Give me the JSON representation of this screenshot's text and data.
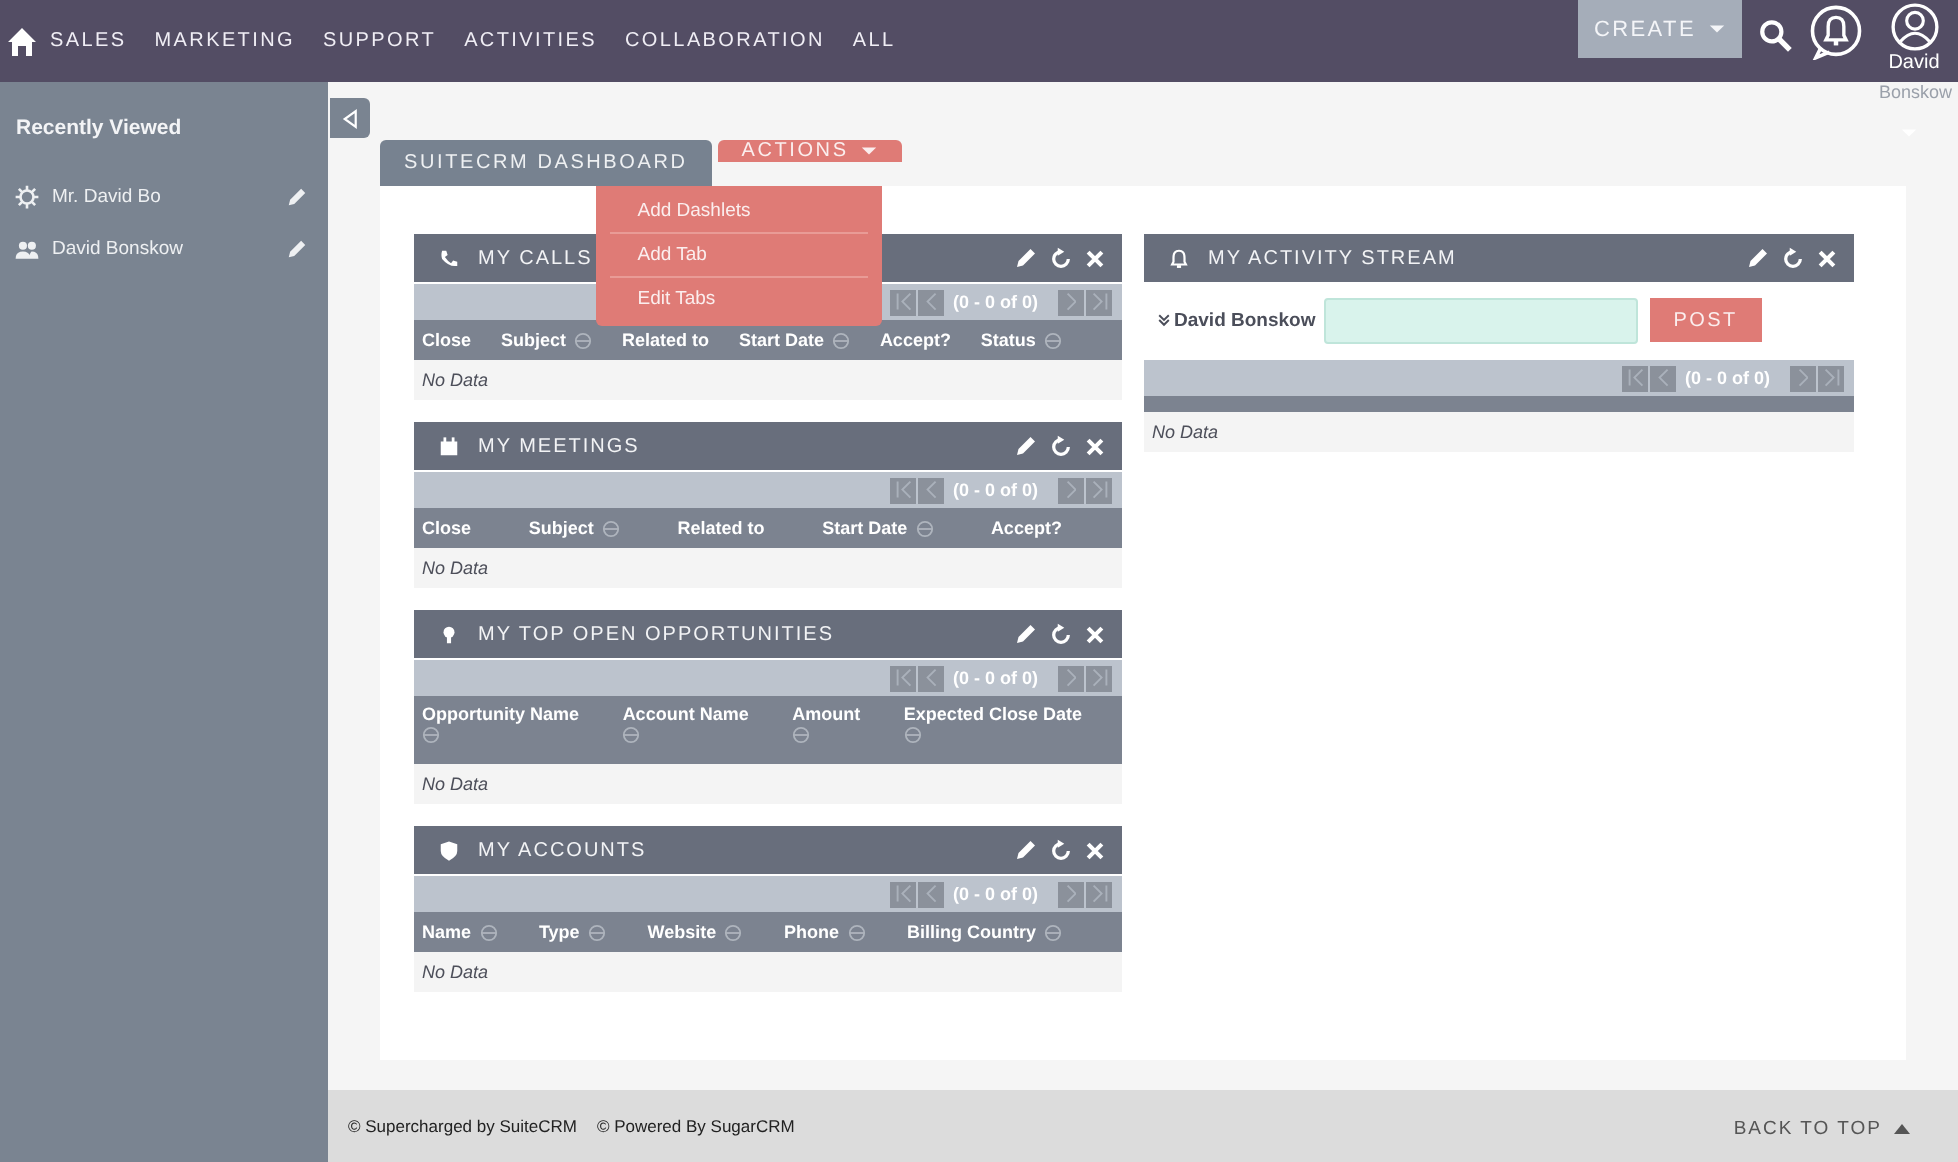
{
  "nav": [
    "SALES",
    "MARKETING",
    "SUPPORT",
    "ACTIVITIES",
    "COLLABORATION",
    "ALL"
  ],
  "top_actions": {
    "create": "CREATE",
    "user_first": "David",
    "user_last": "Bonskow"
  },
  "sidebar": {
    "title": "Recently Viewed",
    "items": [
      {
        "label": "Mr. David Bo",
        "kind": "target"
      },
      {
        "label": "David Bonskow",
        "kind": "contact"
      }
    ]
  },
  "tabs": {
    "dashboard": "SUITECRM DASHBOARD",
    "actions": {
      "label": "ACTIONS",
      "expanded": true,
      "items": [
        "Add Dashlets",
        "Add Tab",
        "Edit Tabs"
      ]
    }
  },
  "dashlets": {
    "left": [
      {
        "kind": "calls",
        "title": "MY CALLS",
        "pagination": "(0 - 0 of 0)",
        "sort_below": false,
        "columns": [
          {
            "label": "Close",
            "sortable": false
          },
          {
            "label": "Subject",
            "sortable": true
          },
          {
            "label": "Related to",
            "sortable": false
          },
          {
            "label": "Start Date",
            "sortable": true
          },
          {
            "label": "Accept?",
            "sortable": false
          },
          {
            "label": "Status",
            "sortable": true
          }
        ],
        "empty": "No Data"
      },
      {
        "kind": "meetings",
        "title": "MY MEETINGS",
        "pagination": "(0 - 0 of 0)",
        "sort_below": false,
        "columns": [
          {
            "label": "Close",
            "sortable": false
          },
          {
            "label": "Subject",
            "sortable": true
          },
          {
            "label": "Related to",
            "sortable": false
          },
          {
            "label": "Start Date",
            "sortable": true
          },
          {
            "label": "Accept?",
            "sortable": false
          }
        ],
        "empty": "No Data"
      },
      {
        "kind": "opportunities",
        "title": "MY TOP OPEN OPPORTUNITIES",
        "pagination": "(0 - 0 of 0)",
        "sort_below": true,
        "columns": [
          {
            "label": "Opportunity Name",
            "sortable": true
          },
          {
            "label": "Account Name",
            "sortable": true
          },
          {
            "label": "Amount",
            "sortable": true
          },
          {
            "label": "Expected Close Date",
            "sortable": true
          }
        ],
        "empty": "No Data"
      },
      {
        "kind": "accounts",
        "title": "MY ACCOUNTS",
        "pagination": "(0 - 0 of 0)",
        "sort_below": false,
        "columns": [
          {
            "label": "Name",
            "sortable": true
          },
          {
            "label": "Type",
            "sortable": true
          },
          {
            "label": "Website",
            "sortable": true
          },
          {
            "label": "Phone",
            "sortable": true
          },
          {
            "label": "Billing Country",
            "sortable": true
          }
        ],
        "empty": "No Data"
      }
    ],
    "right": [
      {
        "kind": "activity",
        "title": "MY ACTIVITY STREAM",
        "user": "David Bonskow",
        "post": "POST",
        "pagination": "(0 - 0 of 0)",
        "empty": "No Data"
      }
    ]
  },
  "footer": {
    "credits": [
      "© Supercharged by SuiteCRM",
      "© Powered By SugarCRM"
    ],
    "back_to_top": "BACK TO TOP"
  }
}
